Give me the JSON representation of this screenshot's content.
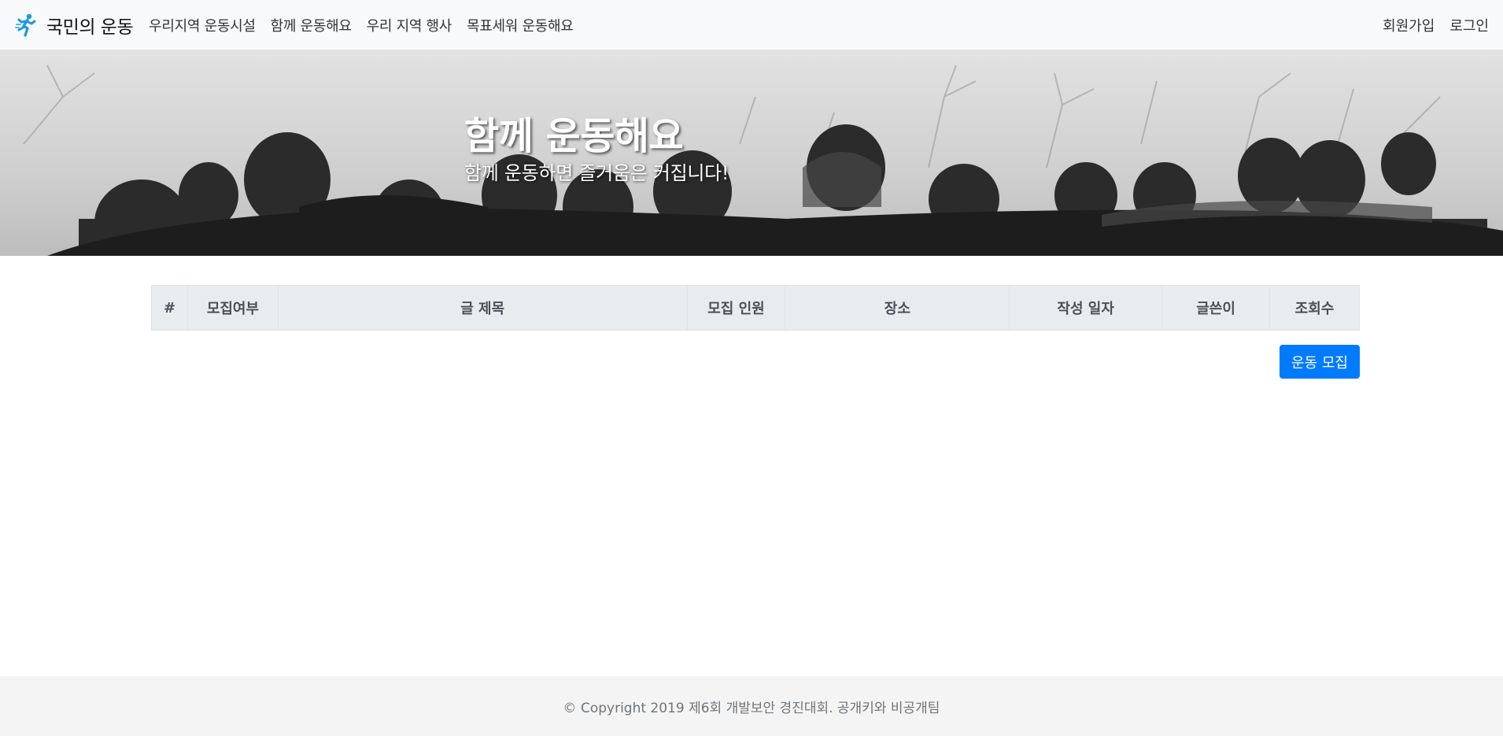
{
  "navbar": {
    "brand": "국민의 운동",
    "logo_icon": "running-person-icon",
    "links": [
      "우리지역 운동시설",
      "함께 운동해요",
      "우리 지역 행사",
      "목표세워 운동해요"
    ],
    "right_links": [
      "회원가입",
      "로그인"
    ]
  },
  "hero": {
    "title": "함께 운동해요",
    "subtitle": "함께 운동하면 즐거움은 커집니다!"
  },
  "table": {
    "headers": [
      "#",
      "모집여부",
      "글 제목",
      "모집 인원",
      "장소",
      "작성 일자",
      "글쓴이",
      "조회수"
    ],
    "rows": []
  },
  "actions": {
    "recruit_button": "운동 모집"
  },
  "footer": {
    "text": "© Copyright 2019 제6회 개발보안 경진대회. 공개키와 비공개팀"
  },
  "colors": {
    "accent": "#007bff",
    "navbar_bg": "#f8f9fa",
    "table_header_bg": "#e9ecef"
  }
}
